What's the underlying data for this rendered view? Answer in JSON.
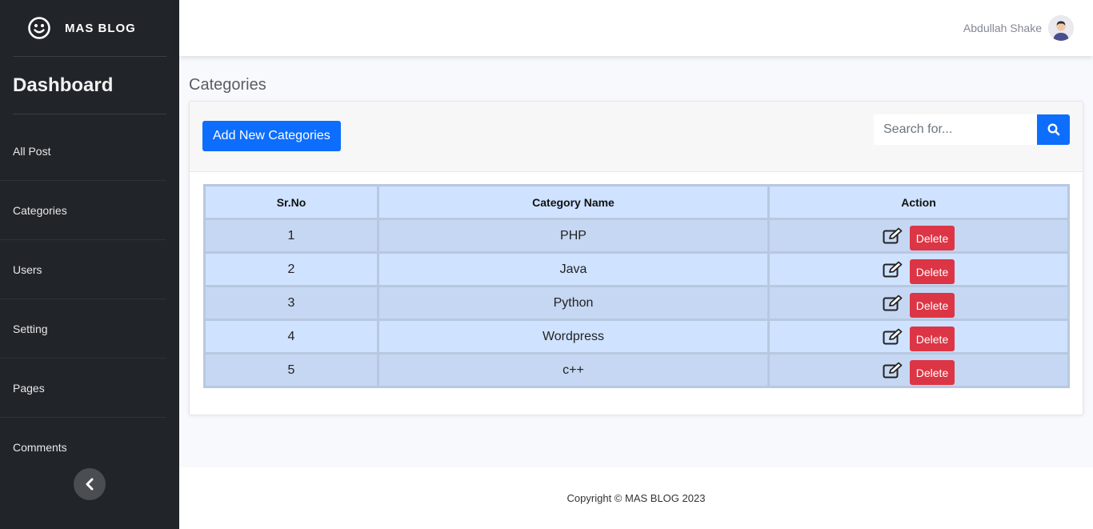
{
  "brand": {
    "name": "MAS BLOG",
    "icon": "smiley-icon"
  },
  "sidebar": {
    "title": "Dashboard",
    "items": [
      {
        "label": "All Post"
      },
      {
        "label": "Categories"
      },
      {
        "label": "Users"
      },
      {
        "label": "Setting"
      },
      {
        "label": "Pages"
      },
      {
        "label": "Comments"
      }
    ],
    "toggle_icon": "chevron-left-icon"
  },
  "topbar": {
    "user_name": "Abdullah Shake",
    "avatar_icon": "user-avatar-icon"
  },
  "main": {
    "page_title": "Categories",
    "add_button_label": "Add New Categories",
    "search": {
      "placeholder": "Search for...",
      "icon": "search-icon"
    },
    "table": {
      "headers": [
        "Sr.No",
        "Category Name",
        "Action"
      ],
      "rows": [
        {
          "sr": "1",
          "name": "PHP",
          "delete_label": "Delete"
        },
        {
          "sr": "2",
          "name": "Java",
          "delete_label": "Delete"
        },
        {
          "sr": "3",
          "name": "Python",
          "delete_label": "Delete"
        },
        {
          "sr": "4",
          "name": "Wordpress",
          "delete_label": "Delete"
        },
        {
          "sr": "5",
          "name": "c++",
          "delete_label": "Delete"
        }
      ]
    }
  },
  "footer": {
    "text": "Copyright © MAS BLOG 2023"
  },
  "colors": {
    "primary": "#0d6efd",
    "danger": "#dc3545",
    "sidebar": "#212529",
    "table_header": "#cfe2ff",
    "table_row_alt": "#c5d7f2"
  }
}
